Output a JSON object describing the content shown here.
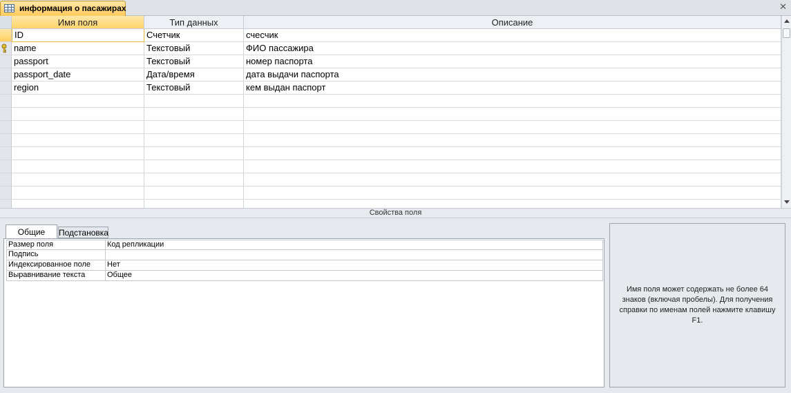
{
  "document_tab": {
    "title": "информация о пасажирах",
    "close_glyph": "✕"
  },
  "grid": {
    "columns": [
      "Имя поля",
      "Тип данных",
      "Описание"
    ],
    "rows": [
      {
        "name": "ID",
        "type": "Счетчик",
        "description": "счесчик"
      },
      {
        "name": "name",
        "type": "Текстовый",
        "description": "ФИО пассажира",
        "primary_key": true
      },
      {
        "name": "passport",
        "type": "Текстовый",
        "description": "номер паспорта"
      },
      {
        "name": "passport_date",
        "type": "Дата/время",
        "description": "дата выдачи паспорта"
      },
      {
        "name": "region",
        "type": "Текстовый",
        "description": "кем выдан паспорт"
      },
      {
        "name": "",
        "type": "",
        "description": ""
      },
      {
        "name": "",
        "type": "",
        "description": ""
      },
      {
        "name": "",
        "type": "",
        "description": ""
      },
      {
        "name": "",
        "type": "",
        "description": ""
      },
      {
        "name": "",
        "type": "",
        "description": ""
      },
      {
        "name": "",
        "type": "",
        "description": ""
      },
      {
        "name": "",
        "type": "",
        "description": ""
      },
      {
        "name": "",
        "type": "",
        "description": ""
      },
      {
        "name": "",
        "type": "",
        "description": ""
      }
    ]
  },
  "properties": {
    "section_title": "Свойства поля",
    "tabs": [
      "Общие",
      "Подстановка"
    ],
    "items": [
      {
        "label": "Размер поля",
        "value": "Код репликации"
      },
      {
        "label": "Подпись",
        "value": ""
      },
      {
        "label": "Индексированное поле",
        "value": "Нет"
      },
      {
        "label": "Выравнивание текста",
        "value": "Общее"
      }
    ],
    "help_text": "Имя поля может содержать не более 64 знаков (включая пробелы). Для получения справки по именам полей нажмите клавишу F1."
  },
  "colors": {
    "accent": "#ffd36b",
    "tab_gold": "#ffca5c"
  }
}
